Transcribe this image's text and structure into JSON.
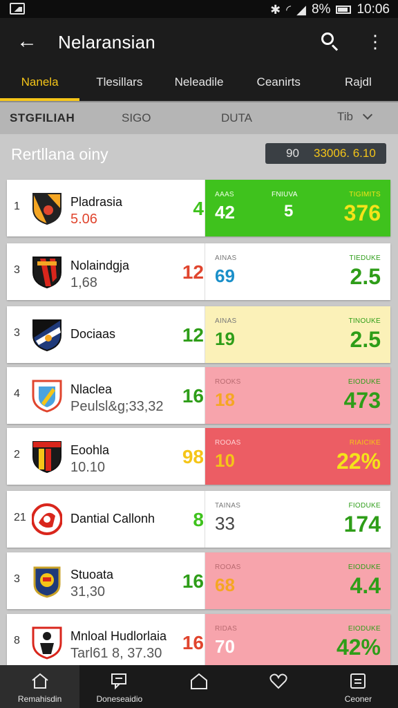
{
  "status": {
    "battery_pct": "8%",
    "time": "10:06"
  },
  "appbar": {
    "title": "Nelaransian"
  },
  "tabs": [
    {
      "label": "Nanela",
      "active": true
    },
    {
      "label": "Tlesillars",
      "active": false
    },
    {
      "label": "Neleadile",
      "active": false
    },
    {
      "label": "Ceanirts",
      "active": false
    },
    {
      "label": "Rajdl",
      "active": false
    }
  ],
  "filter": {
    "col1": "STGFILIAH",
    "col2": "SIGO",
    "col3": "DUTA",
    "select_value": "Tib"
  },
  "section": {
    "title": "Rertllana oiny",
    "pill_left": "90",
    "pill_right": "33006. 6.10"
  },
  "rows": [
    {
      "rank": "1",
      "team": "Pladrasia",
      "sub": "5.06",
      "left_num": "4",
      "cap1": "AAAS",
      "v1": "42",
      "cap2": "FNIUVA",
      "v2": "5",
      "cap3": "TIGIMITS",
      "v3": "376",
      "bg": "#3fc21d"
    },
    {
      "rank": "3",
      "team": "Nolaindgja",
      "sub": "1,68",
      "left_num": "12",
      "cap1": "AINAS",
      "v1": "69",
      "cap2": "",
      "v2": "",
      "cap3": "TIEDUKE",
      "v3": "2.5",
      "bg": "#ffffff"
    },
    {
      "rank": "3",
      "team": "Dociaas",
      "sub": "",
      "left_num": "12",
      "cap1": "AINAS",
      "v1": "19",
      "cap2": "",
      "v2": "",
      "cap3": "TINOUKE",
      "v3": "2.5",
      "bg": "#fbf1b8"
    },
    {
      "rank": "4",
      "team": "Nlaclea",
      "sub": "Peulsl&g;33,32",
      "left_num": "16",
      "cap1": "ROOKS",
      "v1": "18",
      "cap2": "",
      "v2": "",
      "cap3": "EIODUKE",
      "v3": "473",
      "bg": "#f7a4ac"
    },
    {
      "rank": "2",
      "team": "Eoohla",
      "sub": "10.10",
      "left_num": "98",
      "cap1": "ROOAS",
      "v1": "10",
      "cap2": "",
      "v2": "",
      "cap3": "RIAICIKE",
      "v3": "22%",
      "bg": "#ec5d64"
    },
    {
      "rank": "21",
      "team": "Dantial Callonh",
      "sub": "",
      "left_num": "8",
      "cap1": "TAINAS",
      "v1": "33",
      "cap2": "",
      "v2": "",
      "cap3": "FIODUKE",
      "v3": "174",
      "bg": "#ffffff"
    },
    {
      "rank": "3",
      "team": "Stuoata",
      "sub": "31,30",
      "left_num": "16",
      "cap1": "ROOAS",
      "v1": "68",
      "cap2": "",
      "v2": "",
      "cap3": "EIODUKE",
      "v3": "4.4",
      "bg": "#f7a4ac"
    },
    {
      "rank": "8",
      "team": "Mnloal Hudlorlaia",
      "sub": "Tarl61 8, 37.30",
      "left_num": "16",
      "cap1": "RIDAS",
      "v1": "70",
      "cap2": "",
      "v2": "",
      "cap3": "EIODUKE",
      "v3": "42%",
      "bg": "#f7a4ac"
    }
  ],
  "colors": {
    "green": "#3fc21d",
    "yellow": "#f5c518",
    "red": "#e0452e",
    "blue": "#1a8fc9",
    "dark_green": "#2e9d18"
  },
  "crests": [
    "orange-black-shield",
    "red-black-shield",
    "navy-blue-shield",
    "pink-blue-shield",
    "yellow-red-shield",
    "red-white-round",
    "gold-navy-round",
    "red-white-shield"
  ],
  "bottomnav": [
    {
      "label": "Remahisdin",
      "icon": "home-icon"
    },
    {
      "label": "Doneseaidio",
      "icon": "chat-icon"
    },
    {
      "label": "",
      "icon": "house-outline-icon"
    },
    {
      "label": "",
      "icon": "heart-icon"
    },
    {
      "label": "Ceoner",
      "icon": "clipboard-icon"
    }
  ]
}
